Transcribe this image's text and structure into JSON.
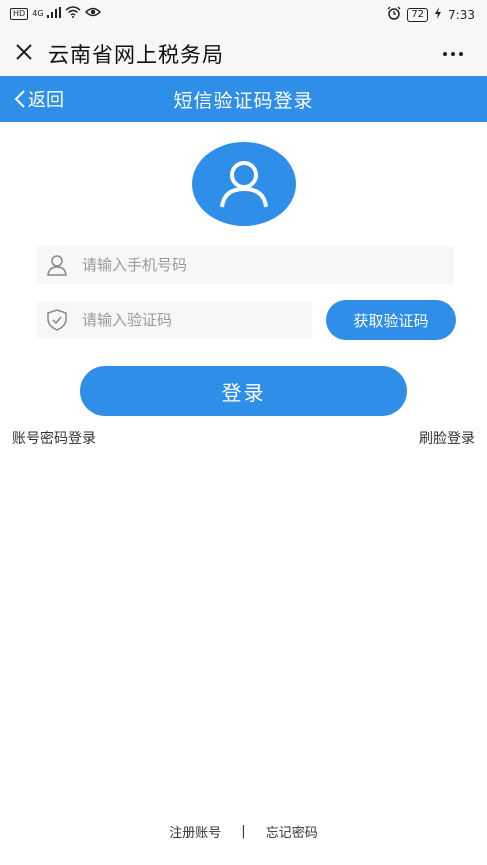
{
  "status_bar": {
    "left_badge": "HD",
    "network": "4G",
    "battery": "72",
    "time": "7:33"
  },
  "app_bar": {
    "title": "云南省网上税务局",
    "close_icon": "close-icon",
    "more_icon": "more-icon"
  },
  "nav_bar": {
    "back_label": "返回",
    "title": "短信验证码登录",
    "color": "#2f8ee8"
  },
  "form": {
    "phone_placeholder": "请输入手机号码",
    "code_placeholder": "请输入验证码",
    "get_code_label": "获取验证码",
    "login_label": "登录"
  },
  "links": {
    "password_login": "账号密码登录",
    "face_login": "刷脸登录"
  },
  "footer": {
    "register": "注册账号",
    "separator": "|",
    "forgot": "忘记密码"
  }
}
